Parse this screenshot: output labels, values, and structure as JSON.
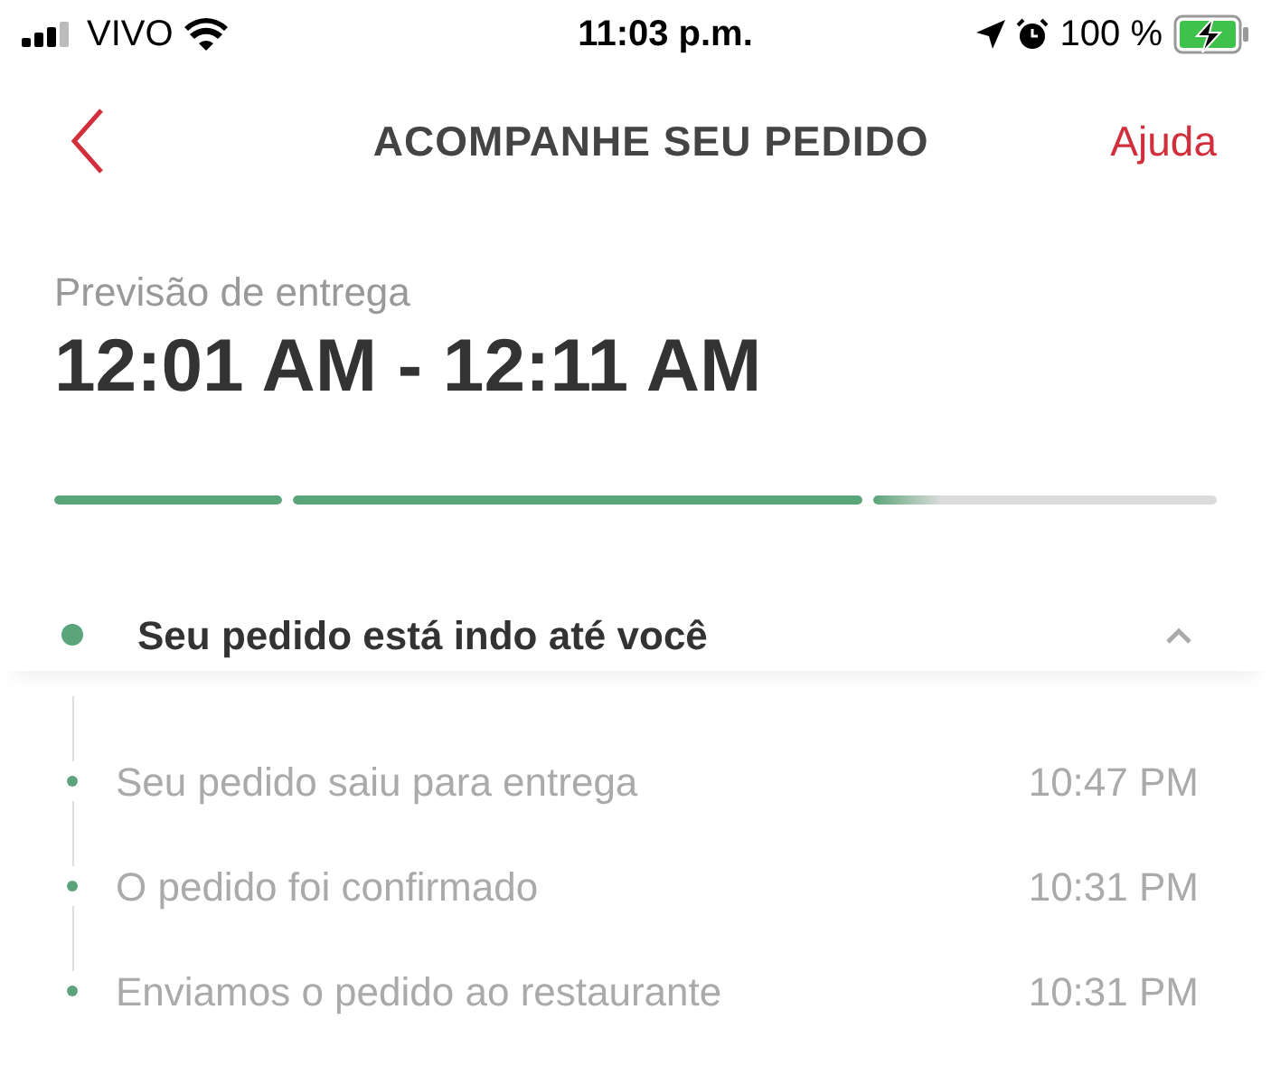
{
  "status_bar": {
    "carrier": "VIVO",
    "time": "11:03 p.m.",
    "battery": "100 %"
  },
  "header": {
    "title": "ACOMPANHE SEU PEDIDO",
    "help": "Ajuda"
  },
  "delivery": {
    "label": "Previsão de entrega",
    "window": "12:01 AM - 12:11 AM"
  },
  "progress": [
    {
      "level": 1
    },
    {
      "level": 1
    },
    {
      "level": 0.2
    }
  ],
  "current_status": {
    "text": "Seu pedido está indo até você",
    "expanded": true
  },
  "history": [
    {
      "text": "Seu pedido saiu para entrega",
      "time": "10:47 PM"
    },
    {
      "text": "O pedido foi confirmado",
      "time": "10:31 PM"
    },
    {
      "text": "Enviamos o pedido ao restaurante",
      "time": "10:31 PM"
    }
  ]
}
